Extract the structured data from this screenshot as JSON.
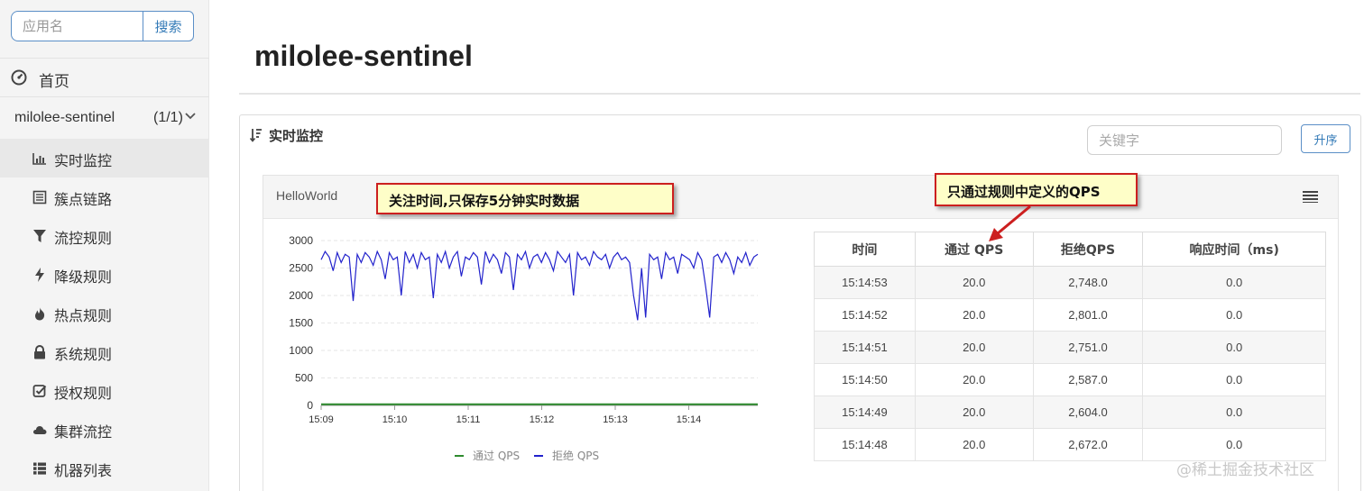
{
  "sidebar": {
    "search_placeholder": "应用名",
    "search_button": "搜索",
    "home_label": "首页",
    "app": {
      "name": "milolee-sentinel",
      "count": "(1/1)"
    },
    "items": [
      {
        "label": "实时监控",
        "icon": "bar-chart-icon",
        "active": true
      },
      {
        "label": "簇点链路",
        "icon": "list-icon"
      },
      {
        "label": "流控规则",
        "icon": "filter-icon"
      },
      {
        "label": "降级规则",
        "icon": "bolt-icon"
      },
      {
        "label": "热点规则",
        "icon": "fire-icon"
      },
      {
        "label": "系统规则",
        "icon": "lock-icon"
      },
      {
        "label": "授权规则",
        "icon": "check-square-icon"
      },
      {
        "label": "集群流控",
        "icon": "cloud-icon"
      },
      {
        "label": "机器列表",
        "icon": "th-list-icon"
      }
    ]
  },
  "main": {
    "title": "milolee-sentinel",
    "panel_title": "实时监控",
    "keyword_placeholder": "关键字",
    "sort_button": "升序",
    "card_title": "HelloWorld"
  },
  "annotations": {
    "note1": "关注时间,只保存5分钟实时数据",
    "note2": "只通过规则中定义的QPS"
  },
  "colors": {
    "pass": "#2e8b2e",
    "block": "#2222cc",
    "note_border": "#cc1f1f",
    "note_bg": "#fefec8"
  },
  "chart_data": {
    "type": "line",
    "x_ticks": [
      "15:09",
      "15:10",
      "15:11",
      "15:12",
      "15:13",
      "15:14"
    ],
    "y_ticks": [
      "3000",
      "2500",
      "2000",
      "1500",
      "1000",
      "500",
      "0"
    ],
    "ylim": [
      0,
      3000
    ],
    "legend_position": "bottom",
    "series": [
      {
        "name": "通过 QPS",
        "color": "#2e8b2e",
        "values": [
          20,
          20,
          20,
          20,
          20,
          20
        ]
      },
      {
        "name": "拒绝 QPS",
        "color": "#2222cc",
        "values": [
          2650,
          2800,
          2700,
          2450,
          2780,
          2600,
          2750,
          2700,
          1900,
          2750,
          2600,
          2780,
          2700,
          2550,
          2800,
          2650,
          2300,
          2780,
          2650,
          2700,
          2000,
          2800,
          2600,
          2750,
          2500,
          2780,
          2650,
          2700,
          1950,
          2750,
          2600,
          2800,
          2500,
          2700,
          2800,
          2350,
          2700,
          2650,
          2780,
          2700,
          2200,
          2800,
          2600,
          2750,
          2650,
          2400,
          2780,
          2700,
          2100,
          2750,
          2650,
          2800,
          2500,
          2700,
          2750,
          2600,
          2780,
          2650,
          2450,
          2800,
          2700,
          2600,
          2750,
          2000,
          2780,
          2650,
          2700,
          2550,
          2800,
          2700,
          2650,
          2750,
          2500,
          2700,
          2780,
          2650,
          2700,
          2600,
          2000,
          1550,
          2500,
          1600,
          2750,
          2650,
          2700,
          2300,
          2780,
          2650,
          2700,
          2400,
          2750,
          2700,
          2650,
          2500,
          2780,
          2650,
          2150,
          1600,
          2700,
          2750,
          2600,
          2780,
          2650,
          2400,
          2700,
          2600,
          2780,
          2550,
          2700,
          2750
        ]
      }
    ]
  },
  "table": {
    "headers": [
      "时间",
      "通过 QPS",
      "拒绝QPS",
      "响应时间（ms)"
    ],
    "rows": [
      [
        "15:14:53",
        "20.0",
        "2,748.0",
        "0.0"
      ],
      [
        "15:14:52",
        "20.0",
        "2,801.0",
        "0.0"
      ],
      [
        "15:14:51",
        "20.0",
        "2,751.0",
        "0.0"
      ],
      [
        "15:14:50",
        "20.0",
        "2,587.0",
        "0.0"
      ],
      [
        "15:14:49",
        "20.0",
        "2,604.0",
        "0.0"
      ],
      [
        "15:14:48",
        "20.0",
        "2,672.0",
        "0.0"
      ]
    ]
  },
  "watermark": "@稀土掘金技术社区"
}
